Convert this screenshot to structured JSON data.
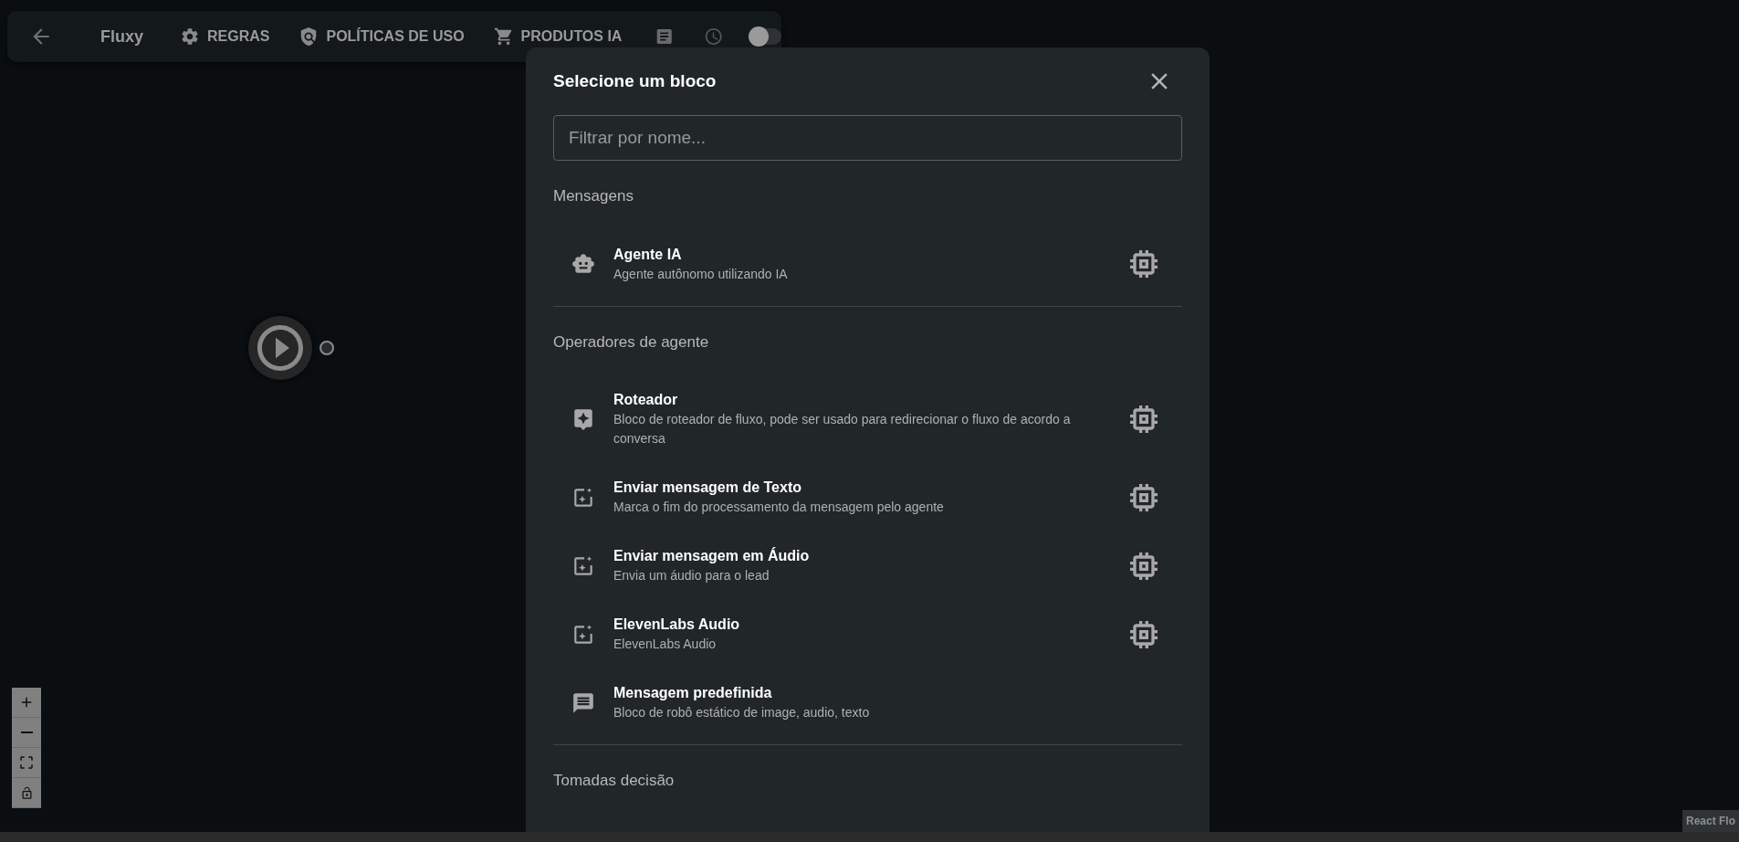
{
  "toolbar": {
    "items": [
      {
        "kind": "back"
      },
      {
        "kind": "brand",
        "label": "Fluxy"
      },
      {
        "kind": "settings",
        "label": "REGRAS"
      },
      {
        "kind": "policy",
        "label": "POLÍTICAS DE USO"
      },
      {
        "kind": "cart",
        "label": "PRODUTOS IA"
      },
      {
        "kind": "article"
      },
      {
        "kind": "clock"
      },
      {
        "kind": "toggle",
        "on": false
      }
    ]
  },
  "dialog": {
    "title": "Selecione um bloco",
    "search": {
      "placeholder": "Filtrar por nome..."
    },
    "sections": [
      {
        "title": "Mensagens",
        "items": [
          {
            "kind": "robot",
            "title": "Agente IA",
            "description": "Agente autônomo utilizando IA",
            "chip": true
          }
        ]
      },
      {
        "title": "Operadores de agente",
        "items": [
          {
            "kind": "router",
            "title": "Roteador",
            "description": "Bloco de roteador de fluxo, pode ser usado para redirecionar o fluxo de acordo a conversa",
            "chip": true
          },
          {
            "kind": "spark",
            "title": "Enviar mensagem de Texto",
            "description": "Marca o fim do processamento da mensagem pelo agente",
            "chip": true
          },
          {
            "kind": "spark",
            "title": "Enviar mensagem em Áudio",
            "description": "Envia um áudio para o lead",
            "chip": true
          },
          {
            "kind": "spark",
            "title": "ElevenLabs Audio",
            "description": "ElevenLabs Audio",
            "chip": true
          },
          {
            "kind": "message",
            "title": "Mensagem predefinida",
            "description": "Bloco de robô estático de image, audio, texto",
            "chip": false
          }
        ]
      },
      {
        "title": "Tomadas decisão"
      }
    ]
  },
  "controls": [
    {
      "kind": "zoom-in"
    },
    {
      "kind": "zoom-out"
    },
    {
      "kind": "fit"
    },
    {
      "kind": "lock"
    }
  ],
  "attribution": "React Flo"
}
